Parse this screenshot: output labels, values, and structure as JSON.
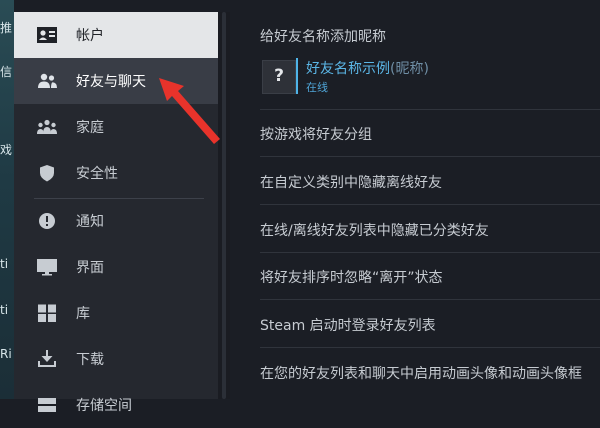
{
  "sidebar": {
    "items": [
      {
        "label": "帐户",
        "icon": "account-card-icon"
      },
      {
        "label": "好友与聊天",
        "icon": "friends-icon"
      },
      {
        "label": "家庭",
        "icon": "family-icon"
      },
      {
        "label": "安全性",
        "icon": "shield-icon"
      },
      {
        "label": "通知",
        "icon": "alert-icon"
      },
      {
        "label": "界面",
        "icon": "monitor-icon"
      },
      {
        "label": "库",
        "icon": "library-grid-icon"
      },
      {
        "label": "下载",
        "icon": "download-icon"
      },
      {
        "label": "存储空间",
        "icon": "storage-icon"
      }
    ]
  },
  "main": {
    "nickname_title": "给好友名称添加昵称",
    "example": {
      "avatar_char": "?",
      "name": "好友名称示例",
      "nickname": "(昵称)",
      "status": "在线"
    },
    "settings": [
      "按游戏将好友分组",
      "在自定义类别中隐藏离线好友",
      "在线/离线好友列表中隐藏已分类好友",
      "将好友排序时忽略“离开”状态",
      "Steam 启动时登录好友列表",
      "在您的好友列表和聊天中启用动画头像和动画头像框"
    ]
  },
  "colors": {
    "accent": "#5bb6e6",
    "arrow": "#e8332b",
    "sidebar_bg": "#25282f",
    "main_bg": "#1b1e25"
  }
}
